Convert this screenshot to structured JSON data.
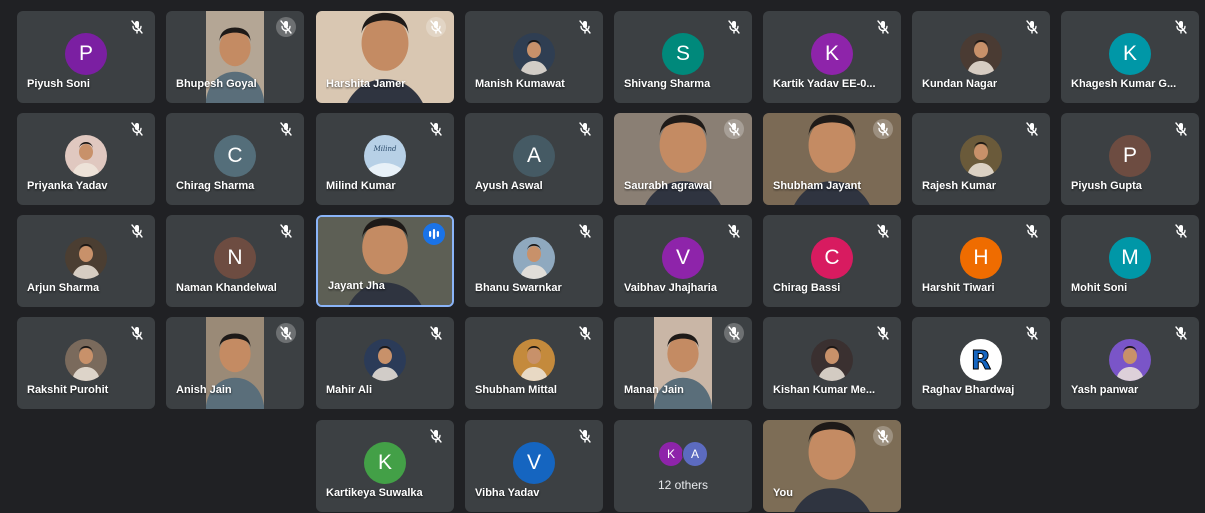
{
  "meeting": {
    "participants": [
      {
        "name": "Piyush Soni",
        "kind": "letter",
        "letter": "P",
        "color": "#7b1fa2"
      },
      {
        "name": "Bhupesh Goyal",
        "kind": "video",
        "tone": "#b4a695",
        "vidSide": "center"
      },
      {
        "name": "Harshita Jamer",
        "kind": "video",
        "tone": "#d9c7b2",
        "vidSide": "full"
      },
      {
        "name": "Manish Kumawat",
        "kind": "photo",
        "tone": "#2f3e52"
      },
      {
        "name": "Shivang Sharma",
        "kind": "letter",
        "letter": "S",
        "color": "#00897b"
      },
      {
        "name": "Kartik Yadav EE-0...",
        "kind": "letter",
        "letter": "K",
        "color": "#8e24aa"
      },
      {
        "name": "Kundan Nagar",
        "kind": "photo",
        "tone": "#4a3b33"
      },
      {
        "name": "Khagesh Kumar G...",
        "kind": "letter",
        "letter": "K",
        "color": "#0097a7"
      },
      {
        "name": "Priyanka Yadav",
        "kind": "photo",
        "tone": "#e0c8c0"
      },
      {
        "name": "Chirag Sharma",
        "kind": "letter",
        "letter": "C",
        "color": "#546e7a"
      },
      {
        "name": "Milind Kumar",
        "kind": "photo",
        "tone": "#b7d0e6",
        "photoText": "Milind"
      },
      {
        "name": "Ayush Aswal",
        "kind": "letter",
        "letter": "A",
        "color": "#455a64"
      },
      {
        "name": "Saurabh agrawal",
        "kind": "video",
        "tone": "#8a7f74",
        "vidSide": "full"
      },
      {
        "name": "Shubham Jayant",
        "kind": "video",
        "tone": "#7b6a55",
        "vidSide": "full"
      },
      {
        "name": "Rajesh Kumar",
        "kind": "photo",
        "tone": "#6a5a3a"
      },
      {
        "name": "Piyush Gupta",
        "kind": "letter",
        "letter": "P",
        "color": "#6d4c41"
      },
      {
        "name": "Arjun Sharma",
        "kind": "photo",
        "tone": "#4b3e32"
      },
      {
        "name": "Naman Khandelwal",
        "kind": "letter",
        "letter": "N",
        "color": "#6d4c41"
      },
      {
        "name": "Jayant Jha",
        "kind": "video",
        "tone": "#5d5f55",
        "vidSide": "full",
        "speaking": true
      },
      {
        "name": "Bhanu Swarnkar",
        "kind": "photo",
        "tone": "#8fa9bf"
      },
      {
        "name": "Vaibhav Jhajharia",
        "kind": "letter",
        "letter": "V",
        "color": "#8e24aa"
      },
      {
        "name": "Chirag Bassi",
        "kind": "letter",
        "letter": "C",
        "color": "#d81b60"
      },
      {
        "name": "Harshit Tiwari",
        "kind": "letter",
        "letter": "H",
        "color": "#ef6c00"
      },
      {
        "name": "Mohit Soni",
        "kind": "letter",
        "letter": "M",
        "color": "#0097a7"
      },
      {
        "name": "Rakshit Purohit",
        "kind": "photo",
        "tone": "#7a6a5c"
      },
      {
        "name": "Anish Jain",
        "kind": "video",
        "tone": "#9a8a77",
        "vidSide": "center"
      },
      {
        "name": "Mahir Ali",
        "kind": "photo",
        "tone": "#2b3b58"
      },
      {
        "name": "Shubham Mittal",
        "kind": "photo",
        "tone": "#c48a3c"
      },
      {
        "name": "Manan Jain",
        "kind": "video",
        "tone": "#c9b6a6",
        "vidSide": "center"
      },
      {
        "name": "Kishan Kumar Me...",
        "kind": "photo",
        "tone": "#3a3030"
      },
      {
        "name": "Raghav Bhardwaj",
        "kind": "photo",
        "tone": "#ffffff",
        "photoText": "R"
      },
      {
        "name": "Yash panwar",
        "kind": "photo",
        "tone": "#7a55c8"
      },
      {
        "name": "Kartikeya Suwalka",
        "kind": "letter",
        "letter": "K",
        "color": "#43a047"
      },
      {
        "name": "Vibha Yadav",
        "kind": "letter",
        "letter": "V",
        "color": "#1565c0"
      },
      {
        "name": "others",
        "kind": "others"
      },
      {
        "name": "You",
        "kind": "video",
        "tone": "#7d6d56",
        "vidSide": "full"
      }
    ],
    "others": {
      "label": "12 others",
      "avatars": [
        {
          "letter": "K",
          "color": "#8e24aa"
        },
        {
          "letter": "A",
          "color": "#5c6bc0"
        }
      ]
    }
  }
}
